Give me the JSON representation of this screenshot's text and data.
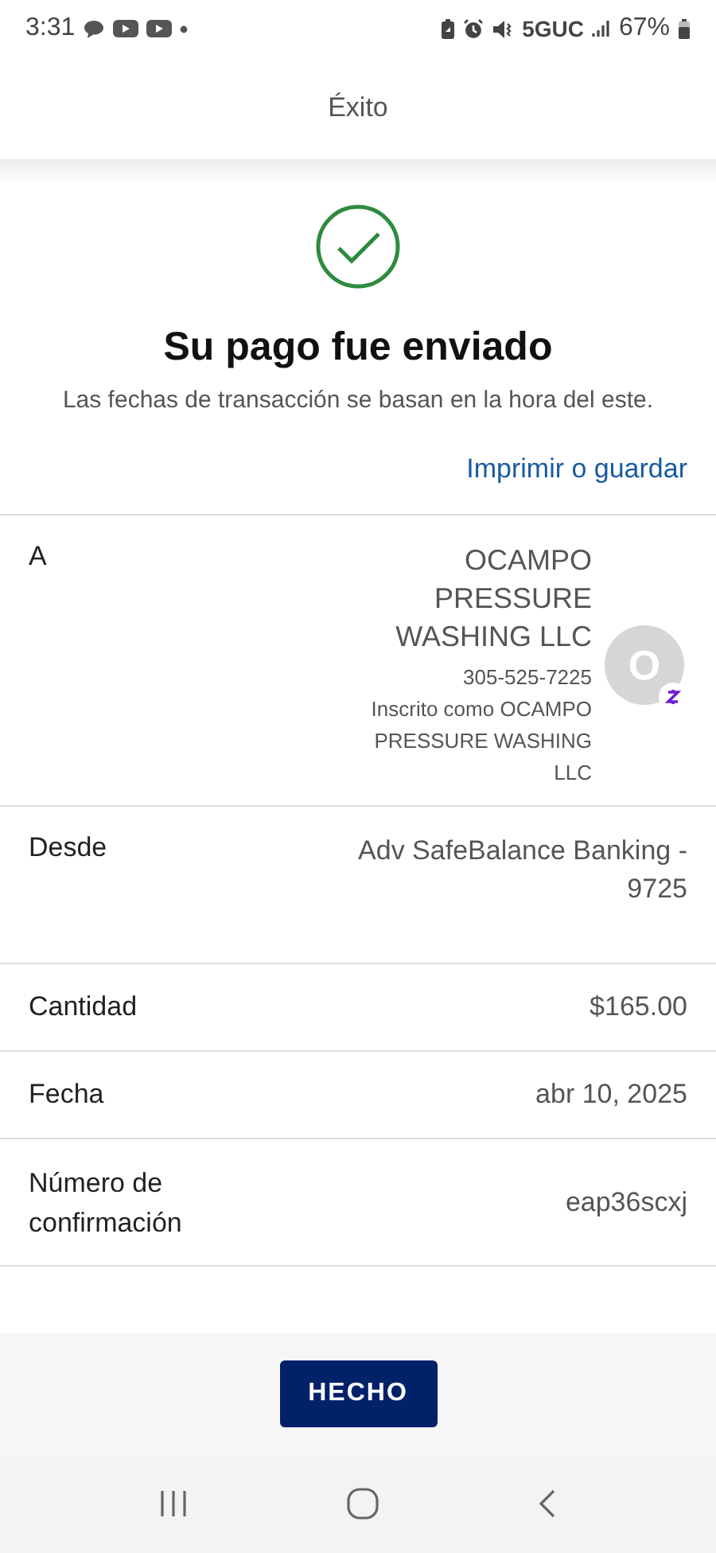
{
  "status_bar": {
    "time": "3:31",
    "network": "5GUC",
    "battery": "67%"
  },
  "header": {
    "title": "Éxito"
  },
  "confirmation": {
    "heading": "Su pago fue enviado",
    "note": "Las fechas de transacción se basan en la hora del este.",
    "action": "Imprimir o guardar"
  },
  "details": [
    {
      "kind": "recipient",
      "label": "A",
      "name": "OCAMPO PRESSURE WASHING LLC",
      "phone": "305-525-7225",
      "enrolled": "Inscrito como OCAMPO PRESSURE WASHING LLC",
      "avatar": "O"
    },
    {
      "kind": "text",
      "label": "Desde",
      "value": "Adv SafeBalance Banking - 9725",
      "tall": true
    },
    {
      "kind": "text",
      "label": "Cantidad",
      "value": "$165.00",
      "tall": false
    },
    {
      "kind": "text",
      "label": "Fecha",
      "value": "abr 10, 2025",
      "tall": false
    },
    {
      "kind": "text",
      "label": "Número de confirmación",
      "value": "eap36scxj",
      "tall": false
    }
  ],
  "button": {
    "label": "HECHO"
  }
}
